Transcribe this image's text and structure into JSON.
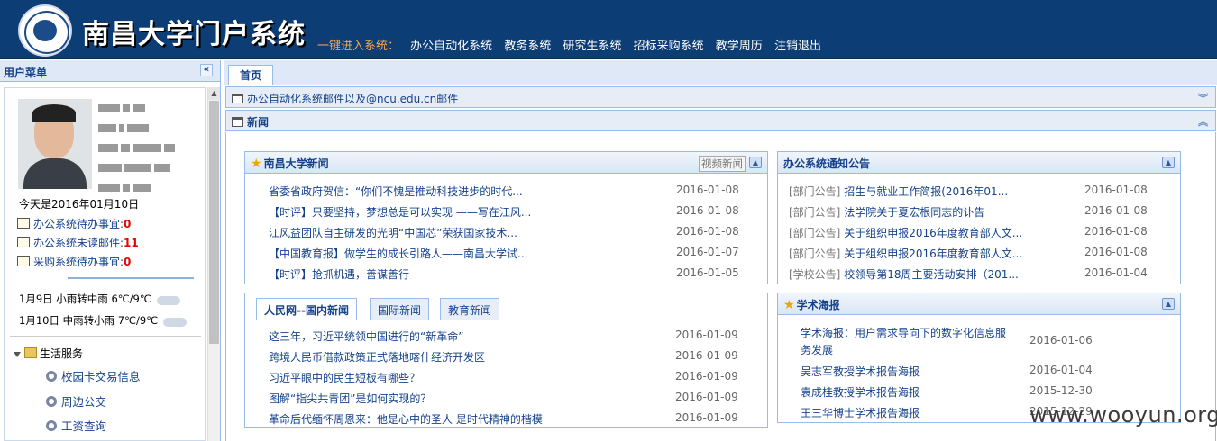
{
  "header": {
    "title": "南昌大学门户系统",
    "quick_label": "一键进入系统：",
    "links": [
      "办公自动化系统",
      "教务系统",
      "研究生系统",
      "招标采购系统",
      "教学周历",
      "注销退出"
    ]
  },
  "sidebar": {
    "title": "用户菜单",
    "collapse_symbol": "«",
    "today": "今天是2016年01月10日",
    "todos": [
      {
        "label": "办公系统待办事宜:",
        "count": "0"
      },
      {
        "label": "办公系统未读邮件:",
        "count": "11"
      },
      {
        "label": "采购系统待办事宜:",
        "count": "0"
      }
    ],
    "weather": [
      {
        "date": "1月9日",
        "desc": "小雨转中雨",
        "temp": "6℃/9℃"
      },
      {
        "date": "1月10日",
        "desc": "中雨转小雨",
        "temp": "7℃/9℃"
      }
    ],
    "tree": {
      "root": "生活服务",
      "items": [
        "校园卡交易信息",
        "周边公交",
        "工资查询"
      ]
    }
  },
  "main": {
    "tab_home": "首页",
    "panel_mail": "办公自动化系统邮件以及@ncu.edu.cn邮件",
    "panel_news": "新闻",
    "expand_symbol": "︾",
    "collapse_symbol": "︽"
  },
  "ncu_news": {
    "title": "南昌大学新闻",
    "video_label": "视频新闻",
    "items": [
      {
        "title": "省委省政府贺信：“你们不愧是推动科技进步的时代...",
        "date": "2016-01-08"
      },
      {
        "title": "【时评】只要坚持，梦想总是可以实现 ——写在江风...",
        "date": "2016-01-08"
      },
      {
        "title": "江风益团队自主研发的光明“中国芯”荣获国家技术...",
        "date": "2016-01-08"
      },
      {
        "title": "【中国教育报】做学生的成长引路人——南昌大学试...",
        "date": "2016-01-07"
      },
      {
        "title": "【时评】抢抓机遇，善谋善行",
        "date": "2016-01-05"
      }
    ]
  },
  "notices": {
    "title": "办公系统通知公告",
    "items": [
      {
        "cat": "[部门公告]",
        "title": "招生与就业工作简报(2016年01...",
        "date": "2016-01-08"
      },
      {
        "cat": "[部门公告]",
        "title": "法学院关于夏宏根同志的讣告",
        "date": "2016-01-08"
      },
      {
        "cat": "[部门公告]",
        "title": "关于组织申报2016年度教育部人文...",
        "date": "2016-01-08"
      },
      {
        "cat": "[部门公告]",
        "title": "关于组织申报2016年度教育部人文...",
        "date": "2016-01-08"
      },
      {
        "cat": "[学校公告]",
        "title": "校领导第18周主要活动安排（201...",
        "date": "2016-01-04"
      }
    ]
  },
  "people_news": {
    "tabs": [
      "人民网--国内新闻",
      "国际新闻",
      "教育新闻"
    ],
    "items": [
      {
        "title": "这三年，习近平统领中国进行的“新革命”",
        "date": "2016-01-09"
      },
      {
        "title": "跨境人民币借款政策正式落地喀什经济开发区",
        "date": "2016-01-09"
      },
      {
        "title": "习近平眼中的民生短板有哪些？",
        "date": "2016-01-09"
      },
      {
        "title": "图解“指尖共青团”是如何实现的？",
        "date": "2016-01-09"
      },
      {
        "title": "革命后代缅怀周恩来：他是心中的圣人 是时代精神的楷模",
        "date": "2016-01-09"
      }
    ]
  },
  "academic": {
    "title": "学术海报",
    "items": [
      {
        "title": "学术海报：用户需求导向下的数字化信息服",
        "title2": "务发展",
        "date": "2016-01-06"
      },
      {
        "title": "吴志军教授学术报告海报",
        "date": "2016-01-04"
      },
      {
        "title": "袁成桂教授学术报告海报",
        "date": "2015-12-30"
      },
      {
        "title": "王三华博士学术报告海报",
        "date": "2015-12-29"
      }
    ]
  },
  "watermark": "www.wooyun.org"
}
